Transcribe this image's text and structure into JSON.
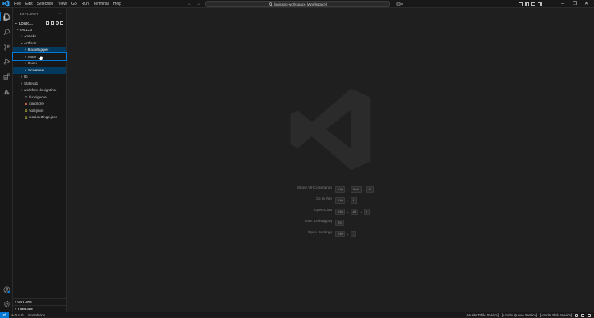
{
  "menu": [
    "File",
    "Edit",
    "Selection",
    "View",
    "Go",
    "Run",
    "Terminal",
    "Help"
  ],
  "search": {
    "text": "logicapp-workspace (Workspace)"
  },
  "sidebar": {
    "title": "EXPLORER",
    "more": "···",
    "workspace": "LOGIC...",
    "tree": [
      {
        "label": "test123",
        "depth": 0,
        "chev": "⌄",
        "icon": ""
      },
      {
        "label": ".vscode",
        "depth": 1,
        "chev": "›",
        "icon": ""
      },
      {
        "label": "Artifacts",
        "depth": 1,
        "chev": "⌄",
        "icon": ""
      },
      {
        "label": "DataMapper",
        "depth": 2,
        "chev": "›",
        "icon": "",
        "sel": true
      },
      {
        "label": "Maps",
        "depth": 2,
        "chev": "›",
        "icon": "",
        "focus": true
      },
      {
        "label": "Rules",
        "depth": 2,
        "chev": "›",
        "icon": ""
      },
      {
        "label": "Schemas",
        "depth": 2,
        "chev": "›",
        "icon": "",
        "sel": true
      },
      {
        "label": "lib",
        "depth": 1,
        "chev": "›",
        "icon": ""
      },
      {
        "label": "Stateful1",
        "depth": 1,
        "chev": "›",
        "icon": ""
      },
      {
        "label": "workflow-designtime",
        "depth": 1,
        "chev": "›",
        "icon": ""
      },
      {
        "label": ".funcignore",
        "depth": 1,
        "chev": "",
        "icon": "≡"
      },
      {
        "label": ".gitignore",
        "depth": 1,
        "chev": "",
        "icon": "◆"
      },
      {
        "label": "host.json",
        "depth": 1,
        "chev": "",
        "icon": "{}"
      },
      {
        "label": "local.settings.json",
        "depth": 1,
        "chev": "",
        "icon": "{}"
      }
    ],
    "outline": "OUTLINE",
    "timeline": "TIMELINE"
  },
  "shortcuts": [
    {
      "label": "Show All Commands",
      "keys": [
        "Ctrl",
        "Shift",
        "P"
      ]
    },
    {
      "label": "Go to File",
      "keys": [
        "Ctrl",
        "P"
      ]
    },
    {
      "label": "Open Chat",
      "keys": [
        "Ctrl",
        "Alt",
        "I"
      ]
    },
    {
      "label": "Start Debugging",
      "keys": [
        "F5"
      ]
    },
    {
      "label": "Open Settings",
      "keys": [
        "Ctrl",
        ","
      ]
    }
  ],
  "status": {
    "remote": "⇌",
    "problems": "⊗ 0  ⚠ 0",
    "solution": "No Solution",
    "items": [
      "[Azurite Table Service]",
      "[Azurite Queue Service]",
      "[Azurite Blob Service]"
    ]
  },
  "colors": {
    "accent": "#0078d4",
    "selection": "#04395e",
    "bg": "#1f1f1f",
    "panel": "#181818"
  }
}
